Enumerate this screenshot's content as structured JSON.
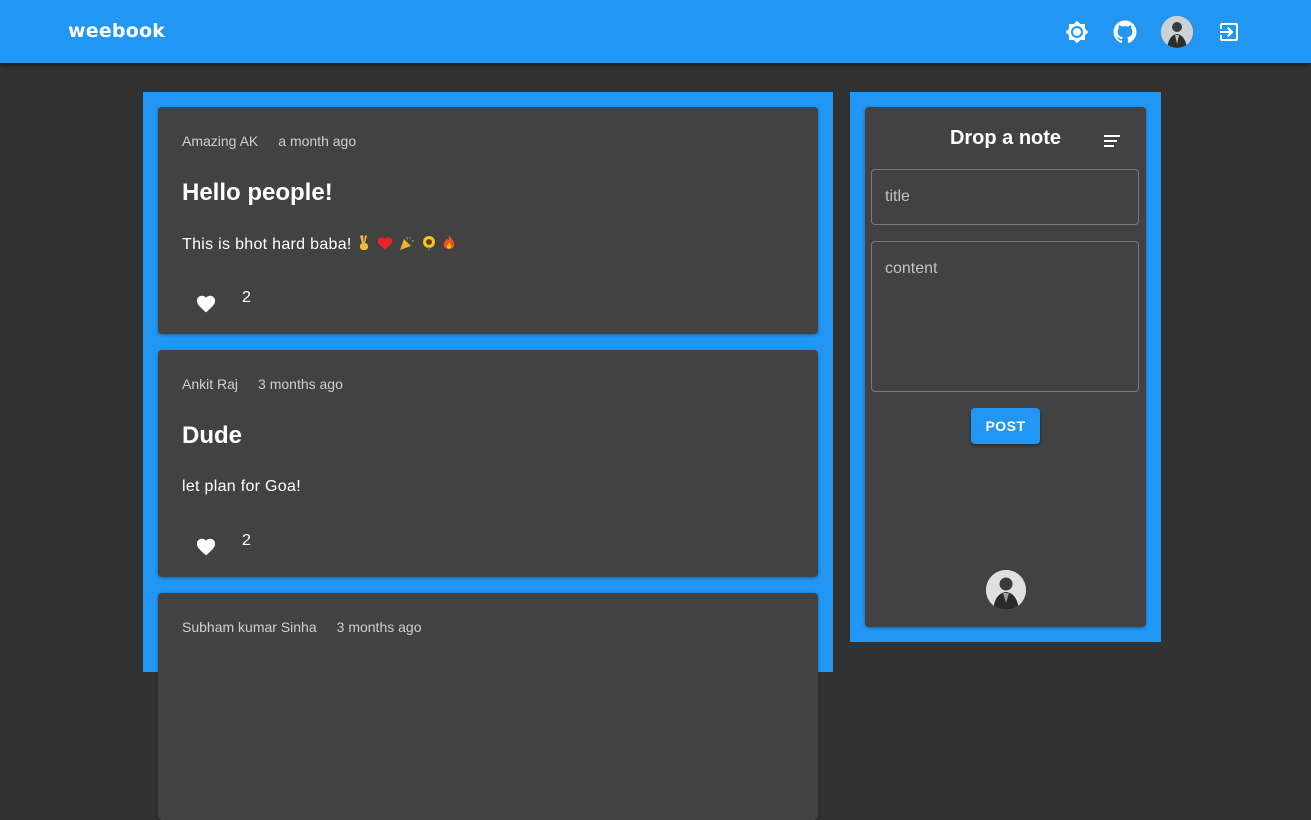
{
  "app": {
    "brand": "weebook"
  },
  "header": {
    "icons": [
      "brightness-icon",
      "github-icon",
      "user-avatar",
      "logout-icon"
    ]
  },
  "posts": [
    {
      "author": "Amazing AK",
      "time": "a month ago",
      "title": "Hello people!",
      "body": "This is bhot hard baba!",
      "emojis": [
        "✌",
        "❤",
        "🎉",
        "🌻",
        "🔥"
      ],
      "likes": "2"
    },
    {
      "author": "Ankit Raj",
      "time": "3 months ago",
      "title": "Dude",
      "body": "let plan for Goa!",
      "likes": "2"
    },
    {
      "author": "Subham kumar Sinha",
      "time": "3 months ago",
      "title": "",
      "body": "",
      "likes": ""
    }
  ],
  "note": {
    "heading": "Drop a note",
    "title_placeholder": "title",
    "content_placeholder": "content",
    "post_label": "POST"
  },
  "colors": {
    "primary": "#2196f3",
    "background": "#323232",
    "card": "#424242"
  }
}
